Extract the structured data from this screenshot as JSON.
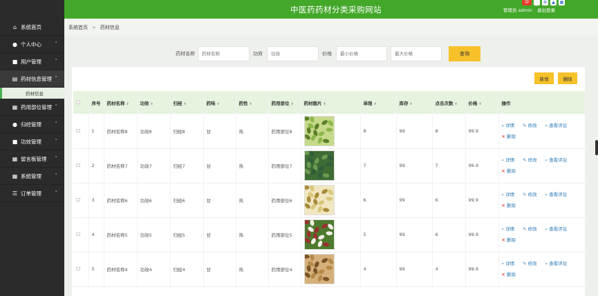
{
  "header": {
    "title": "中医药药材分类采购网站",
    "user_text": "管理员 admin",
    "logout_label": "退出登录",
    "badge": "中"
  },
  "sidebar": {
    "items": [
      {
        "label": "系统首页",
        "icon": "home-icon",
        "glyph": "⌂",
        "chevron": ""
      },
      {
        "label": "个人中心",
        "icon": "person-icon",
        "glyph": "●",
        "chevron": "˅"
      },
      {
        "label": "用户管理",
        "icon": "folder-icon",
        "glyph": "■",
        "chevron": "˅"
      },
      {
        "label": "药材信息管理",
        "icon": "document-icon",
        "glyph": "▤",
        "chevron": "˄"
      },
      {
        "label": "药用部位管理",
        "icon": "grid-icon",
        "glyph": "▦",
        "chevron": "˅"
      },
      {
        "label": "归经管理",
        "icon": "person-icon",
        "glyph": "●",
        "chevron": "˅"
      },
      {
        "label": "功效管理",
        "icon": "folder-icon",
        "glyph": "■",
        "chevron": "˅"
      },
      {
        "label": "留言板管理",
        "icon": "grid-icon",
        "glyph": "▦",
        "chevron": "˅"
      },
      {
        "label": "系统管理",
        "icon": "grid-icon",
        "glyph": "▦",
        "chevron": "˅"
      },
      {
        "label": "订单管理",
        "icon": "list-icon",
        "glyph": "☰",
        "chevron": "˅"
      }
    ],
    "sub_item": "药材信息"
  },
  "breadcrumb": {
    "home": "系统首页",
    "sep": ">",
    "current": "药材信息"
  },
  "search": {
    "name_label": "药材名称",
    "name_placeholder": "药材名称",
    "effect_label": "功效",
    "effect_placeholder": "功效",
    "price_label": "价格",
    "min_placeholder": "最小价格",
    "max_placeholder": "最大价格",
    "query_label": "查询"
  },
  "toolbar": {
    "add_label": "新增",
    "delete_label": "删除"
  },
  "table": {
    "headers": [
      "序号",
      "药材名称",
      "功效",
      "归经",
      "药味",
      "药性",
      "药用部位",
      "药材图片",
      "单限",
      "库存",
      "点击次数",
      "价格",
      "操作"
    ],
    "rows": [
      {
        "no": "1",
        "name": "药材名称8",
        "effect": "功效8",
        "meridian": "归经8",
        "taste": "甘",
        "nature": "热",
        "part": "药用部位8",
        "limit": "8",
        "stock": "99",
        "clicks": "8",
        "price": "99.9"
      },
      {
        "no": "2",
        "name": "药材名称7",
        "effect": "功效7",
        "meridian": "归经7",
        "taste": "甘",
        "nature": "热",
        "part": "药用部位7",
        "limit": "7",
        "stock": "99",
        "clicks": "7",
        "price": "99.9"
      },
      {
        "no": "3",
        "name": "药材名称6",
        "effect": "功效6",
        "meridian": "归经6",
        "taste": "甘",
        "nature": "热",
        "part": "药用部位6",
        "limit": "6",
        "stock": "99",
        "clicks": "6",
        "price": "99.9"
      },
      {
        "no": "4",
        "name": "药材名称5",
        "effect": "功效5",
        "meridian": "归经5",
        "taste": "甘",
        "nature": "热",
        "part": "药用部位5",
        "limit": "5",
        "stock": "99",
        "clicks": "6",
        "price": "99.9"
      },
      {
        "no": "5",
        "name": "药材名称4",
        "effect": "功效4",
        "meridian": "归经4",
        "taste": "甘",
        "nature": "热",
        "part": "药用部位4",
        "limit": "4",
        "stock": "99",
        "clicks": "4",
        "price": "99.9"
      }
    ],
    "ops": {
      "detail": "详情",
      "edit": "修改",
      "comments": "查看评论",
      "delete": "删除"
    }
  },
  "colors": {
    "header_green": "#43a82a",
    "sidebar_dark": "#2b2b2b",
    "button_yellow": "#f7c12a",
    "header_row": "#e6f3df"
  }
}
